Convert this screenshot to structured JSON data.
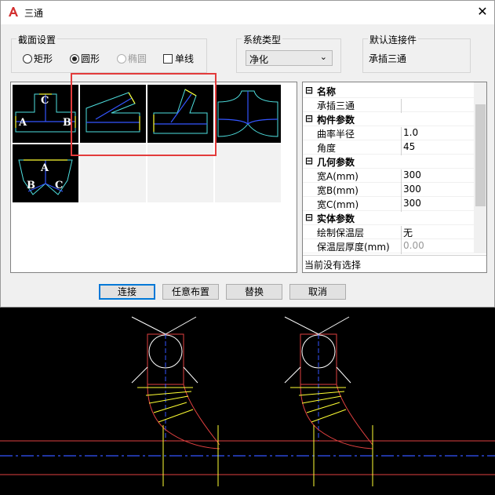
{
  "window": {
    "title": "三通",
    "close_glyph": "✕",
    "app_icon": "autocad-a-icon",
    "accent": "#d32f2f"
  },
  "section": {
    "title": "截面设置",
    "options": [
      {
        "label": "矩形",
        "selected": false,
        "disabled": false
      },
      {
        "label": "圆形",
        "selected": true,
        "disabled": false
      },
      {
        "label": "椭圆",
        "selected": false,
        "disabled": true
      }
    ],
    "single_line": {
      "label": "单线",
      "checked": false
    }
  },
  "system_type": {
    "title": "系统类型",
    "value": "净化"
  },
  "default_connector": {
    "title": "默认连接件",
    "value": "承插三通"
  },
  "preview_tiles": [
    {
      "labels": [
        "C",
        "A",
        "B"
      ]
    },
    {
      "labels": []
    },
    {
      "labels": []
    },
    {
      "labels": []
    },
    {
      "labels": [
        "A",
        "B",
        "C"
      ]
    }
  ],
  "properties": [
    {
      "type": "category",
      "sign": "⊟",
      "label": "名称"
    },
    {
      "type": "item",
      "name": "承插三通",
      "value": ""
    },
    {
      "type": "category",
      "sign": "⊟",
      "label": "构件参数"
    },
    {
      "type": "item",
      "name": "曲率半径",
      "value": "1.0"
    },
    {
      "type": "item",
      "name": "角度",
      "value": "45"
    },
    {
      "type": "category",
      "sign": "⊟",
      "label": "几何参数"
    },
    {
      "type": "item",
      "name": "宽A(mm)",
      "value": "300"
    },
    {
      "type": "item",
      "name": "宽B(mm)",
      "value": "300"
    },
    {
      "type": "item",
      "name": "宽C(mm)",
      "value": "300"
    },
    {
      "type": "category",
      "sign": "⊟",
      "label": "实体参数"
    },
    {
      "type": "item",
      "name": "绘制保温层",
      "value": "无"
    },
    {
      "type": "item",
      "name": "保温层厚度(mm)",
      "value": "0.00",
      "disabled": true
    }
  ],
  "status": "当前没有选择",
  "buttons": {
    "connect": "连接",
    "free_layout": "任意布置",
    "replace": "替换",
    "cancel": "取消"
  }
}
